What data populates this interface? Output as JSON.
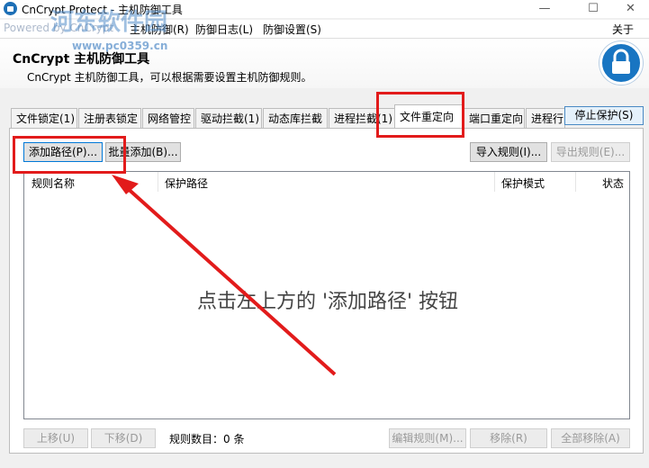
{
  "window": {
    "title": "CnCrypt Protect - 主机防御工具",
    "min_label": "—",
    "max_label": "☐",
    "close_label": "✕"
  },
  "watermark": {
    "text": "河东软件园",
    "url": "www.pc0359.cn",
    "powered": "Powered by CnCrypt"
  },
  "menu": {
    "items": [
      "主机防御(R)",
      "防御日志(L)",
      "防御设置(S)"
    ],
    "about": "关于(A)"
  },
  "header": {
    "title": "CnCrypt 主机防御工具",
    "subtitle": "CnCrypt 主机防御工具，可以根据需要设置主机防御规则。"
  },
  "tabs": [
    "文件锁定(1)",
    "注册表锁定",
    "网络管控",
    "驱动拦截(1)",
    "动态库拦截",
    "进程拦截(1)",
    "文件重定向",
    "端口重定向",
    "进程行"
  ],
  "active_tab_index": 6,
  "stop_protect_label": "停止保护(S)",
  "toolbar": {
    "add_path": "添加路径(P)...",
    "batch_add": "批量添加(B)...",
    "import_rules": "导入规则(I)...",
    "export_rules": "导出规则(E)..."
  },
  "table": {
    "columns": [
      "规则名称",
      "保护路径",
      "保护模式",
      "状态"
    ],
    "rows": [],
    "empty_message": "点击左上方的 '添加路径' 按钮"
  },
  "footer": {
    "move_up": "上移(U)",
    "move_down": "下移(D)",
    "rule_count_label": "规则数目：0 条",
    "edit_rule": "编辑规则(M)...",
    "remove": "移除(R)",
    "remove_all": "全部移除(A)"
  },
  "colors": {
    "accent": "#1875c2",
    "annotation_red": "#e21b1b"
  }
}
